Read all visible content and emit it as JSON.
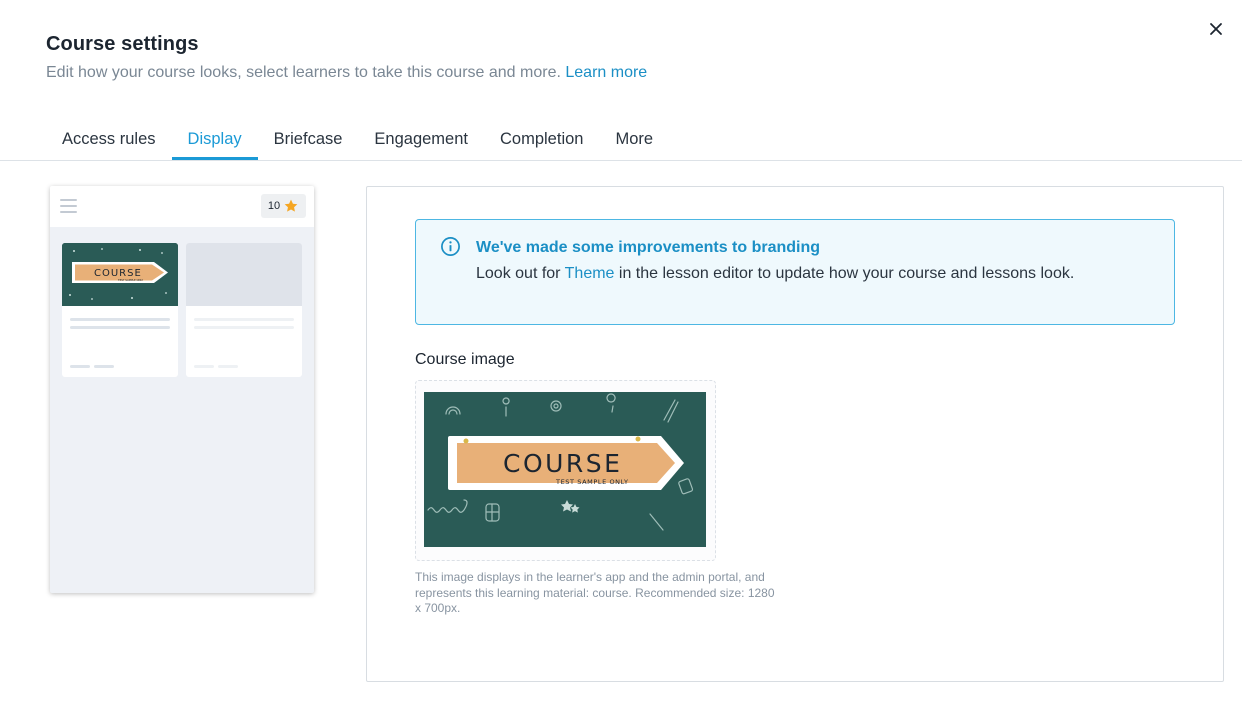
{
  "header": {
    "title": "Course settings",
    "subtitle": "Edit how your course looks, select learners to take this course and more.",
    "learn_more": "Learn more",
    "close_icon": "close-icon"
  },
  "tabs": [
    {
      "label": "Access rules",
      "active": false
    },
    {
      "label": "Display",
      "active": true
    },
    {
      "label": "Briefcase",
      "active": false
    },
    {
      "label": "Engagement",
      "active": false
    },
    {
      "label": "Completion",
      "active": false
    },
    {
      "label": "More",
      "active": false
    }
  ],
  "preview": {
    "score": "10",
    "menu_icon": "hamburger-icon",
    "star_icon": "star-icon",
    "thumbnail_text": "COURSE",
    "thumbnail_subtext": "TEST SAMPLE ONLY"
  },
  "info_banner": {
    "icon": "info-icon",
    "title": "We've made some improvements to branding",
    "body_before": "Look out for ",
    "body_link": "Theme",
    "body_after": " in the lesson editor to update how your course and lessons look."
  },
  "course_image": {
    "label": "Course image",
    "image_title": "COURSE",
    "image_subtitle": "TEST SAMPLE ONLY",
    "hint": "This image displays in the learner's app and the admin portal, and represents this learning material: course. Recommended size: 1280 x 700px."
  },
  "colors": {
    "accent": "#1b9ad6",
    "link": "#1b8fc5",
    "chalkboard": "#2a5b56",
    "sign": "#e8b078",
    "star": "#f5a623"
  }
}
